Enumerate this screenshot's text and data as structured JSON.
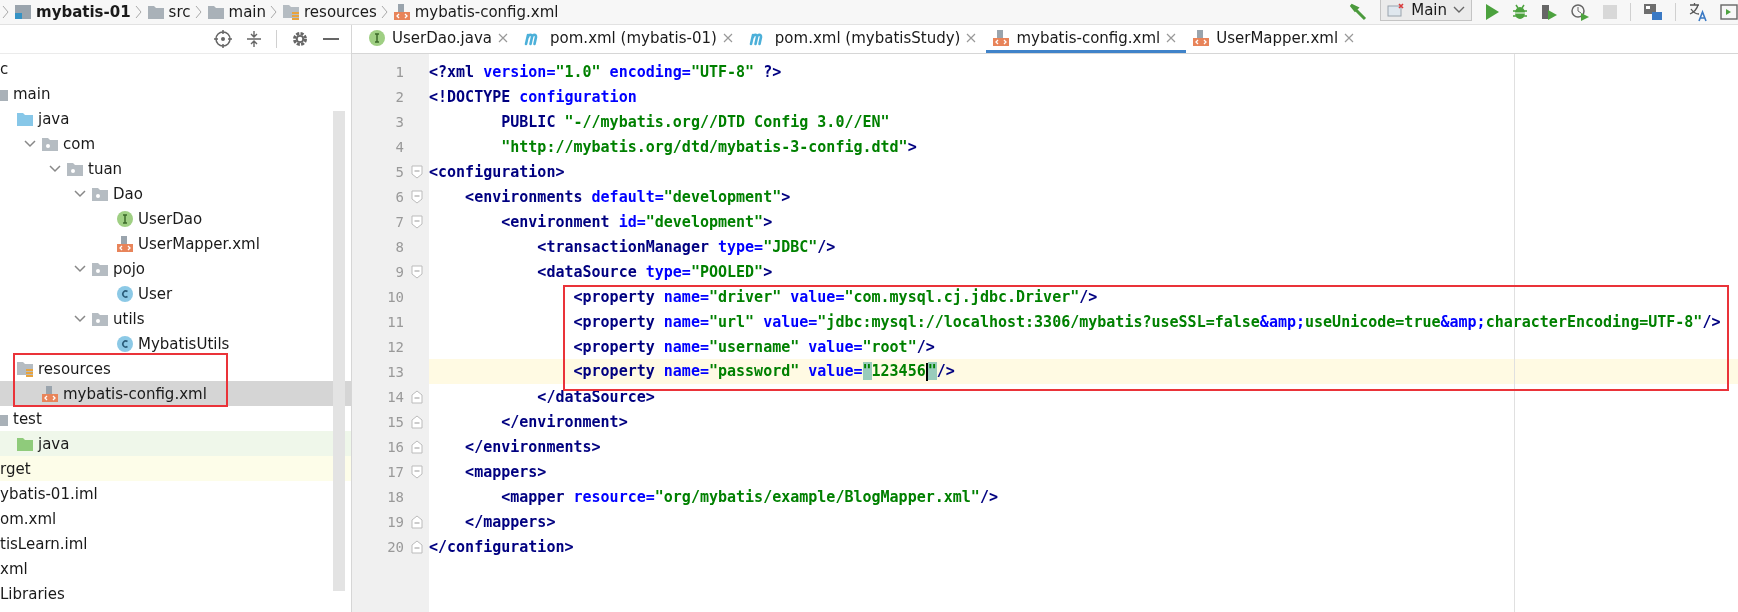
{
  "breadcrumbs": [
    {
      "label": "mybatis-01",
      "kind": "module"
    },
    {
      "label": "src",
      "kind": "folder"
    },
    {
      "label": "main",
      "kind": "folder"
    },
    {
      "label": "resources",
      "kind": "resources"
    },
    {
      "label": "mybatis-config.xml",
      "kind": "xml"
    }
  ],
  "toolbar": {
    "run_configuration": "Main",
    "stop_button": {
      "disabled": true
    }
  },
  "project_tree": [
    {
      "label": "c",
      "kind": "cut",
      "selected": false,
      "children": [
        {
          "label": "main",
          "kind": "folder",
          "selected": false,
          "children": [
            {
              "label": "java",
              "kind": "source-folder",
              "selected": false,
              "children": [
                {
                  "label": "com",
                  "kind": "package",
                  "expanded": true,
                  "selected": false,
                  "children": [
                    {
                      "label": "tuan",
                      "kind": "package",
                      "expanded": true,
                      "selected": false,
                      "children": [
                        {
                          "label": "Dao",
                          "kind": "package",
                          "expanded": true,
                          "selected": false,
                          "children": [
                            {
                              "label": "UserDao",
                              "kind": "interface",
                              "selected": false
                            },
                            {
                              "label": "UserMapper.xml",
                              "kind": "xml",
                              "selected": false
                            }
                          ]
                        },
                        {
                          "label": "pojo",
                          "kind": "package",
                          "expanded": true,
                          "selected": false,
                          "children": [
                            {
                              "label": "User",
                              "kind": "class",
                              "selected": false
                            }
                          ]
                        },
                        {
                          "label": "utils",
                          "kind": "package",
                          "expanded": true,
                          "selected": false,
                          "children": [
                            {
                              "label": "MybatisUtils",
                              "kind": "class",
                              "selected": false
                            }
                          ]
                        }
                      ]
                    }
                  ]
                }
              ]
            },
            {
              "label": "resources",
              "kind": "resources-folder",
              "selected": false,
              "children": [
                {
                  "label": "mybatis-config.xml",
                  "kind": "xml",
                  "selected": true
                }
              ]
            }
          ]
        },
        {
          "label": "test",
          "kind": "folder",
          "selected": false,
          "children": [
            {
              "label": "java",
              "kind": "test-folder",
              "color": "#eff7ea",
              "selected": false
            }
          ]
        }
      ]
    },
    {
      "label": "rget",
      "kind": "cut",
      "color": "#fdfde9",
      "selected": false
    },
    {
      "label": "ybatis-01.iml",
      "kind": "cut",
      "selected": false
    },
    {
      "label": "om.xml",
      "kind": "cut",
      "selected": false
    },
    {
      "label": "tisLearn.iml",
      "kind": "cut",
      "selected": false
    },
    {
      "label": "xml",
      "kind": "cut",
      "selected": false
    },
    {
      "label": "Libraries",
      "kind": "cut",
      "selected": false
    }
  ],
  "tabs": [
    {
      "label": "UserDao.java",
      "kind": "interface",
      "selected": false
    },
    {
      "label": "pom.xml (mybatis-01)",
      "kind": "maven",
      "selected": false
    },
    {
      "label": "pom.xml (mybatisStudy)",
      "kind": "maven",
      "selected": false
    },
    {
      "label": "mybatis-config.xml",
      "kind": "xml",
      "selected": true
    },
    {
      "label": "UserMapper.xml",
      "kind": "xml",
      "selected": false
    }
  ],
  "editor": {
    "lines": [
      {
        "number": "1",
        "kind": "plain",
        "current": false,
        "tokens": [
          {
            "kind": "tag",
            "text": "<?xml"
          },
          {
            "kind": "attr",
            "text": " version="
          },
          {
            "kind": "value",
            "text": "\"1.0\""
          },
          {
            "kind": "attr",
            "text": " encoding="
          },
          {
            "kind": "value",
            "text": "\"UTF-8\""
          },
          {
            "kind": "tag",
            "text": " ?>"
          }
        ]
      },
      {
        "number": "2",
        "kind": "plain",
        "current": false,
        "tokens": [
          {
            "kind": "tag",
            "text": "<!DOCTYPE"
          },
          {
            "kind": "attr",
            "text": " configuration"
          }
        ]
      },
      {
        "number": "3",
        "kind": "plain",
        "current": false,
        "tokens": [
          {
            "kind": "tag",
            "text": "        PUBLIC"
          },
          {
            "kind": "value",
            "text": " \"-//mybatis.org//DTD Config 3.0//EN\""
          }
        ]
      },
      {
        "number": "4",
        "kind": "plain",
        "current": false,
        "tokens": [
          {
            "kind": "value",
            "text": "        \"http://mybatis.org/dtd/mybatis-3-config.dtd\""
          },
          {
            "kind": "tag",
            "text": ">"
          }
        ]
      },
      {
        "number": "5",
        "kind": "fold-start",
        "current": false,
        "tokens": [
          {
            "kind": "tag",
            "text": "<configuration>"
          }
        ]
      },
      {
        "number": "6",
        "kind": "fold-start",
        "current": false,
        "tokens": [
          {
            "kind": "tag",
            "text": "    <environments"
          },
          {
            "kind": "attr",
            "text": " default="
          },
          {
            "kind": "value",
            "text": "\"development\""
          },
          {
            "kind": "tag",
            "text": ">"
          }
        ]
      },
      {
        "number": "7",
        "kind": "fold-start",
        "current": false,
        "tokens": [
          {
            "kind": "tag",
            "text": "        <environment"
          },
          {
            "kind": "attr",
            "text": " id="
          },
          {
            "kind": "value",
            "text": "\"development\""
          },
          {
            "kind": "tag",
            "text": ">"
          }
        ]
      },
      {
        "number": "8",
        "kind": "plain",
        "current": false,
        "tokens": [
          {
            "kind": "tag",
            "text": "            <transactionManager"
          },
          {
            "kind": "attr",
            "text": " type="
          },
          {
            "kind": "value",
            "text": "\"JDBC\""
          },
          {
            "kind": "tag",
            "text": "/>"
          }
        ]
      },
      {
        "number": "9",
        "kind": "fold-start",
        "current": false,
        "tokens": [
          {
            "kind": "tag",
            "text": "            <dataSource"
          },
          {
            "kind": "attr",
            "text": " type="
          },
          {
            "kind": "value",
            "text": "\"POOLED\""
          },
          {
            "kind": "tag",
            "text": ">"
          }
        ]
      },
      {
        "number": "10",
        "kind": "plain",
        "current": false,
        "tokens": [
          {
            "kind": "tag",
            "text": "                <property"
          },
          {
            "kind": "attr",
            "text": " name="
          },
          {
            "kind": "value",
            "text": "\"driver\""
          },
          {
            "kind": "attr",
            "text": " value="
          },
          {
            "kind": "value",
            "text": "\"com.mysql.cj.jdbc.Driver\""
          },
          {
            "kind": "tag",
            "text": "/>"
          }
        ]
      },
      {
        "number": "11",
        "kind": "plain",
        "current": false,
        "tokens": [
          {
            "kind": "tag",
            "text": "                <property"
          },
          {
            "kind": "attr",
            "text": " name="
          },
          {
            "kind": "value",
            "text": "\"url\""
          },
          {
            "kind": "attr",
            "text": " value="
          },
          {
            "kind": "value",
            "text": "\"jdbc:mysql://localhost:3306/mybatis?useSSL=false"
          },
          {
            "kind": "entity",
            "text": "&amp;"
          },
          {
            "kind": "value",
            "text": "useUnicode=true"
          },
          {
            "kind": "entity",
            "text": "&amp;"
          },
          {
            "kind": "value",
            "text": "characterEncoding=UTF-8\""
          },
          {
            "kind": "tag",
            "text": "/>"
          }
        ]
      },
      {
        "number": "12",
        "kind": "plain",
        "current": false,
        "tokens": [
          {
            "kind": "tag",
            "text": "                <property"
          },
          {
            "kind": "attr",
            "text": " name="
          },
          {
            "kind": "value",
            "text": "\"username\""
          },
          {
            "kind": "attr",
            "text": " value="
          },
          {
            "kind": "value",
            "text": "\"root\""
          },
          {
            "kind": "tag",
            "text": "/>"
          }
        ]
      },
      {
        "number": "13",
        "kind": "plain",
        "current": true,
        "tokens": [
          {
            "kind": "tag",
            "text": "                <property"
          },
          {
            "kind": "attr",
            "text": " name="
          },
          {
            "kind": "value",
            "text": "\"password\""
          },
          {
            "kind": "attr",
            "text": " value="
          },
          {
            "kind": "match",
            "text": "\""
          },
          {
            "kind": "value",
            "text": "123456",
            "caret_after": true
          },
          {
            "kind": "match",
            "text": "\""
          },
          {
            "kind": "tag",
            "text": "/>"
          }
        ]
      },
      {
        "number": "14",
        "kind": "fold-end",
        "current": false,
        "tokens": [
          {
            "kind": "tag",
            "text": "            </dataSource>"
          }
        ]
      },
      {
        "number": "15",
        "kind": "fold-end",
        "current": false,
        "tokens": [
          {
            "kind": "tag",
            "text": "        </environment>"
          }
        ]
      },
      {
        "number": "16",
        "kind": "fold-end",
        "current": false,
        "tokens": [
          {
            "kind": "tag",
            "text": "    </environments>"
          }
        ]
      },
      {
        "number": "17",
        "kind": "fold-start",
        "current": false,
        "tokens": [
          {
            "kind": "tag",
            "text": "    <mappers>"
          }
        ]
      },
      {
        "number": "18",
        "kind": "plain",
        "current": false,
        "tokens": [
          {
            "kind": "tag",
            "text": "        <mapper"
          },
          {
            "kind": "attr",
            "text": " resource="
          },
          {
            "kind": "value",
            "text": "\"org/mybatis/example/BlogMapper.xml\""
          },
          {
            "kind": "tag",
            "text": "/>"
          }
        ]
      },
      {
        "number": "19",
        "kind": "fold-end",
        "current": false,
        "tokens": [
          {
            "kind": "tag",
            "text": "    </mappers>"
          }
        ]
      },
      {
        "number": "20",
        "kind": "fold-end",
        "current": false,
        "tokens": [
          {
            "kind": "tag",
            "text": "</configuration>"
          }
        ]
      }
    ]
  }
}
